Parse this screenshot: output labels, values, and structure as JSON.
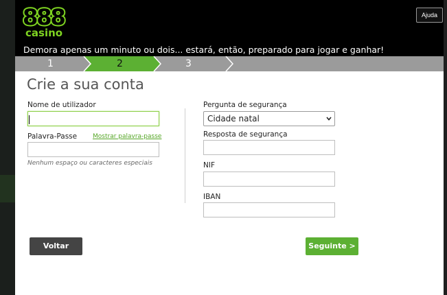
{
  "header": {
    "logo_main": "888",
    "logo_sub": "casino",
    "help_label": "Ajuda",
    "tagline": "Demora apenas um minuto ou dois... estará, então, preparado para jogar e ganhar!"
  },
  "steps": {
    "items": [
      "1",
      "2",
      "3"
    ],
    "active": "2"
  },
  "form": {
    "title": "Crie a sua conta",
    "username_label": "Nome de utilizador",
    "username_value": "",
    "password_label": "Palavra-Passe",
    "show_password_link": "Mostrar palavra-passe",
    "password_value": "",
    "password_hint": "Nenhum espaço ou caracteres especiais",
    "security_question_label": "Pergunta de segurança",
    "security_question_selected": "Cidade natal",
    "security_answer_label": "Resposta de segurança",
    "security_answer_value": "",
    "nif_label": "NIF",
    "nif_value": "",
    "iban_label": "IBAN",
    "iban_value": ""
  },
  "buttons": {
    "back_label": "Voltar",
    "next_label": "Seguinte >"
  },
  "colors": {
    "brand_green": "#7ed321",
    "next_button": "#5cb033",
    "back_button": "#444444",
    "steps_bar": "#9b9b9b"
  }
}
